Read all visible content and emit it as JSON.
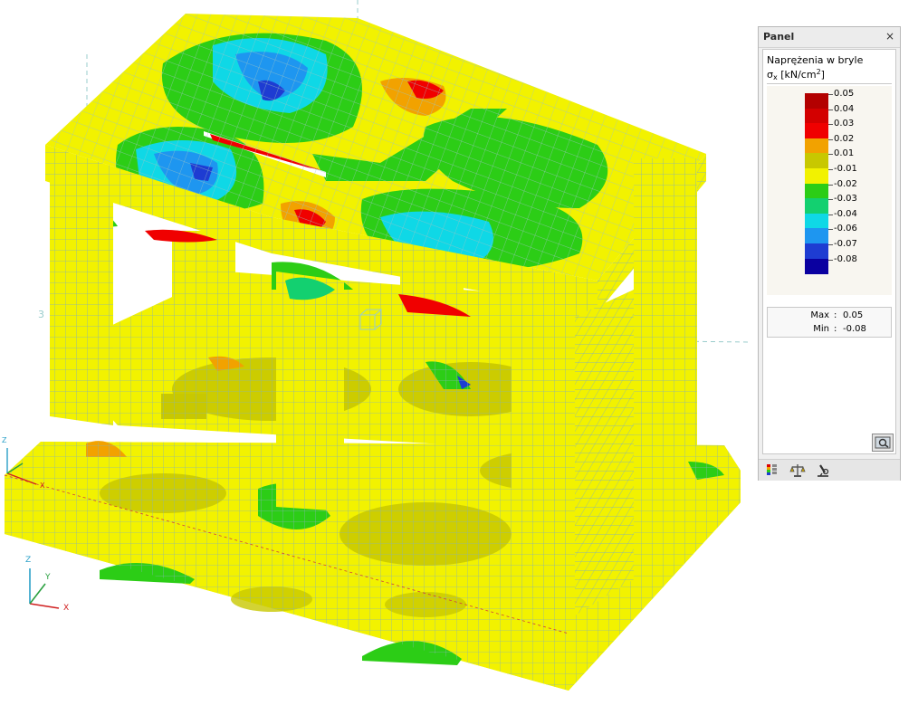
{
  "panel": {
    "title": "Panel",
    "close_glyph": "×",
    "result_title": "Naprężenia w bryle",
    "result_symbol": "σ",
    "result_index": "x",
    "result_unit_open": " [kN/cm",
    "result_unit_power": "2",
    "result_unit_close": "]",
    "scale": [
      {
        "label": "0.05",
        "color": "#b30000"
      },
      {
        "label": "0.04",
        "color": "#d30000"
      },
      {
        "label": "0.03",
        "color": "#f00000"
      },
      {
        "label": "0.02",
        "color": "#f2a200"
      },
      {
        "label": "0.01",
        "color": "#c8c800"
      },
      {
        "label": "-0.01",
        "color": "#f2f200"
      },
      {
        "label": "-0.02",
        "color": "#2ccd16"
      },
      {
        "label": "-0.03",
        "color": "#13d070"
      },
      {
        "label": "-0.04",
        "color": "#0fd8e6"
      },
      {
        "label": "-0.06",
        "color": "#1e96f0"
      },
      {
        "label": "-0.07",
        "color": "#1e3cd2"
      },
      {
        "label": "-0.08",
        "color": "#0a00a0"
      }
    ],
    "max_label": "Max",
    "min_label": "Min",
    "colon": ":",
    "max_value": "0.05",
    "min_value": "-0.08",
    "settings_icon": "display-settings-icon",
    "toolbar_icons": [
      "color-scale-icon",
      "balance-icon",
      "microscope-icon"
    ]
  },
  "viewport": {
    "axis_labels": {
      "z": "Z",
      "y": "Y",
      "x": "X"
    },
    "small_axis_labels": {
      "z": "Z",
      "x": "X"
    },
    "node_label": "3",
    "colors": {
      "yellow": "#f2f200",
      "olive": "#c8c800",
      "green": "#2ccd16",
      "teal": "#13d070",
      "cyan": "#0fd8e6",
      "blue": "#1e96f0",
      "dark_blue": "#1e3cd2",
      "orange": "#f2a200",
      "red": "#f00000",
      "mesh": "#7fb0b0"
    }
  }
}
